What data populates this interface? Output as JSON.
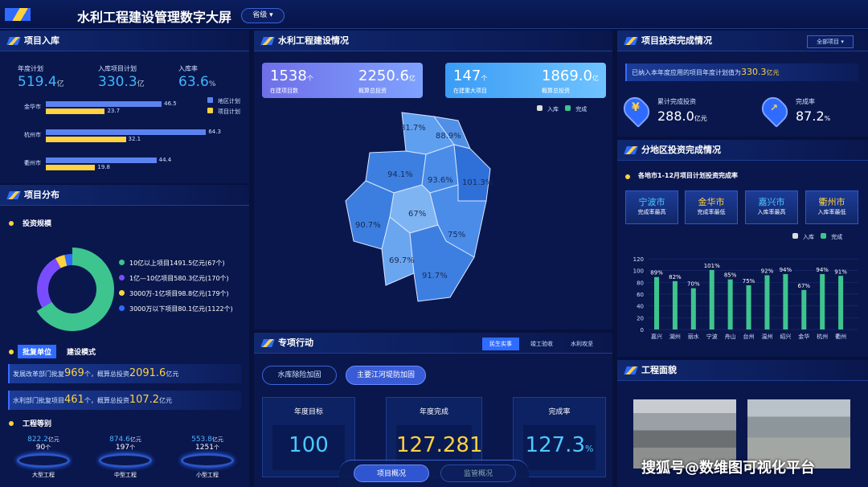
{
  "header": {
    "title": "水利工程建设管理数字大屏",
    "scope": "省级"
  },
  "left": {
    "ruku": {
      "title": "项目入库",
      "stats": [
        {
          "label": "年度计划",
          "value": "519.4",
          "unit": "亿"
        },
        {
          "label": "入库项目计划",
          "value": "330.3",
          "unit": "亿"
        },
        {
          "label": "入库率",
          "value": "63.6",
          "unit": "%"
        }
      ],
      "legend": [
        "地区计划",
        "项目计划"
      ],
      "bars": [
        {
          "city": "金华市",
          "a": 46.5,
          "b": 23.7
        },
        {
          "city": "杭州市",
          "a": 64.3,
          "b": 32.1
        },
        {
          "city": "衢州市",
          "a": 44.4,
          "b": 19.8
        }
      ]
    },
    "fenbu": {
      "title": "项目分布",
      "sub": "投资规模",
      "items": [
        {
          "text": "10亿以上项目1491.5亿元(67个)",
          "color": "#3ec48f",
          "value": 1491.5
        },
        {
          "text": "1亿—10亿项目580.3亿元(170个)",
          "color": "#7a4cff",
          "value": 580.3
        },
        {
          "text": "3000万-1亿项目98.8亿元(179个)",
          "color": "#ffd23f",
          "value": 98.8
        },
        {
          "text": "3000万以下项目80.1亿元(1122个)",
          "color": "#2f6bff",
          "value": 80.1
        }
      ],
      "tab": "批复单位",
      "tab2": "建设模式",
      "rows": [
        {
          "pre": "发展改革部门批复",
          "num": "969",
          "mid": "个，概算总投资",
          "amt": "2091.6",
          "unit": "亿元"
        },
        {
          "pre": "水利部门批复项目",
          "num": "461",
          "mid": "个，概算总投资",
          "amt": "107.2",
          "unit": "亿元"
        }
      ],
      "grade": "工程等别",
      "grades": [
        {
          "amt": "822.2",
          "au": "亿元",
          "cnt": "90",
          "cu": "个",
          "name": "大型工程"
        },
        {
          "amt": "874.6",
          "au": "亿元",
          "cnt": "197",
          "cu": "个",
          "name": "中型工程"
        },
        {
          "amt": "553.8",
          "au": "亿元",
          "cnt": "1251",
          "cu": "个",
          "name": "小型工程"
        }
      ]
    }
  },
  "center": {
    "title": "水利工程建设情况",
    "cards": [
      {
        "v1": "1538",
        "u1": "个",
        "l1": "在建项目数",
        "v2": "2250.6",
        "u2": "亿",
        "l2": "概算总投资"
      },
      {
        "v1": "147",
        "u1": "个",
        "l1": "在建重大项目",
        "v2": "1869.0",
        "u2": "亿",
        "l2": "概算总投资"
      }
    ],
    "legend": [
      "入库",
      "完成"
    ],
    "map": [
      "81.7%",
      "88.9%",
      "94.1%",
      "93.6%",
      "101.3%",
      "67%",
      "90.7%",
      "75%",
      "69.7%",
      "91.7%"
    ],
    "action": {
      "title": "专项行动",
      "tabs": [
        "民生实事",
        "竣工验收",
        "水利攻坚"
      ],
      "buttons": [
        "水库除险加固",
        "主要江河堤防加固"
      ],
      "tiles": [
        {
          "label": "年度目标",
          "value": "100",
          "unit": ""
        },
        {
          "label": "年度完成",
          "value": "127.281",
          "unit": ""
        },
        {
          "label": "完成率",
          "value": "127.3",
          "unit": "%"
        }
      ]
    },
    "bottom": [
      "项目概况",
      "监管概况"
    ]
  },
  "right": {
    "invest": {
      "title": "项目投资完成情况",
      "filter": "全部项目",
      "note_pre": "已纳入本年度应用的项目年度计划值为",
      "note_val": "330.3",
      "note_unit": "亿元",
      "s1": {
        "label": "累计完成投资",
        "value": "288.0",
        "unit": "亿元"
      },
      "s2": {
        "label": "完成率",
        "value": "87.2",
        "unit": "%"
      }
    },
    "region": {
      "title": "分地区投资完成情况",
      "sub": "各地市1-12月项目计划投资完成率",
      "cities": [
        {
          "name": "宁波市",
          "desc": "完成率最高"
        },
        {
          "name": "金华市",
          "desc": "完成率最低"
        },
        {
          "name": "嘉兴市",
          "desc": "入库率最高"
        },
        {
          "name": "衢州市",
          "desc": "入库率最低"
        }
      ],
      "legend": [
        "入库",
        "完成"
      ]
    },
    "photo": {
      "title": "工程面貌"
    }
  },
  "watermark": "搜狐号@数维图可视化平台",
  "chart_data": {
    "type": "bar",
    "categories": [
      "嘉兴",
      "湖州",
      "丽水",
      "宁波",
      "舟山",
      "台州",
      "温州",
      "绍兴",
      "金华",
      "杭州",
      "衢州"
    ],
    "series": [
      {
        "name": "完成",
        "values": [
          89,
          82,
          70,
          101,
          85,
          75,
          92,
          94,
          67,
          94,
          91
        ]
      }
    ],
    "labels": [
      "89%",
      "82%",
      "70%",
      "101%",
      "85%",
      "75%",
      "92%",
      "94%",
      "67%",
      "94%",
      "91%"
    ],
    "yticks": [
      "0",
      "20",
      "40",
      "60",
      "80",
      "100",
      "120"
    ],
    "ylim": [
      0,
      120
    ]
  }
}
